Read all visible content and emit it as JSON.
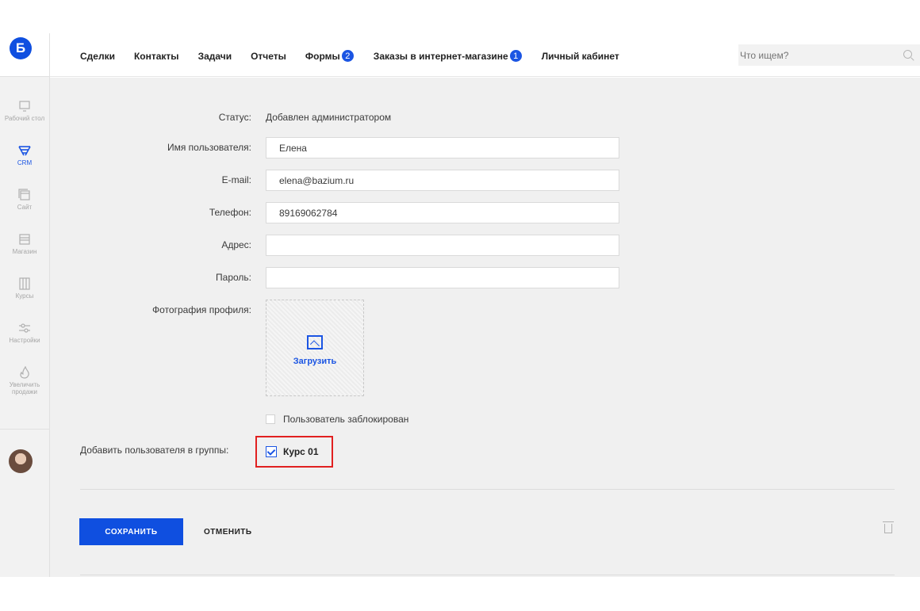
{
  "logo": {
    "letter": "Б",
    "color": "#0f4fe0"
  },
  "sidebar": {
    "items": [
      {
        "label": "Рабочий стол",
        "icon": "monitor-icon",
        "active": false
      },
      {
        "label": "CRM",
        "icon": "funnel-icon",
        "active": true
      },
      {
        "label": "Сайт",
        "icon": "site-icon",
        "active": false
      },
      {
        "label": "Магазин",
        "icon": "store-icon",
        "active": false
      },
      {
        "label": "Курсы",
        "icon": "courses-icon",
        "active": false
      },
      {
        "label": "Настройки",
        "icon": "settings-sliders-icon",
        "active": false
      },
      {
        "label": "Увеличить продажи",
        "icon": "flame-icon",
        "active": false
      }
    ]
  },
  "topnav": {
    "items": [
      {
        "label": "Сделки"
      },
      {
        "label": "Контакты"
      },
      {
        "label": "Задачи"
      },
      {
        "label": "Отчеты"
      },
      {
        "label": "Формы",
        "badge": "2"
      },
      {
        "label": "Заказы в интернет-магазине",
        "badge": "1"
      },
      {
        "label": "Личный кабинет"
      }
    ],
    "search_placeholder": "Что ищем?"
  },
  "form": {
    "status_label": "Статус:",
    "status_value": "Добавлен администратором",
    "username_label": "Имя пользователя:",
    "username_value": "Елена",
    "email_label": "E-mail:",
    "email_value": "elena@bazium.ru",
    "phone_label": "Телефон:",
    "phone_value": "89169062784",
    "address_label": "Адрес:",
    "address_value": "",
    "password_label": "Пароль:",
    "password_value": "",
    "photo_label": "Фотография профиля:",
    "upload_label": "Загрузить",
    "blocked_label": "Пользователь заблокирован",
    "blocked_checked": false,
    "groups_label": "Добавить пользователя в группы:",
    "group_name": "Курс 01",
    "group_checked": true
  },
  "actions": {
    "save_label": "СОХРАНИТЬ",
    "cancel_label": "ОТМЕНИТЬ"
  },
  "colors": {
    "accent": "#0f4fe0",
    "highlight_border": "#e12020"
  }
}
